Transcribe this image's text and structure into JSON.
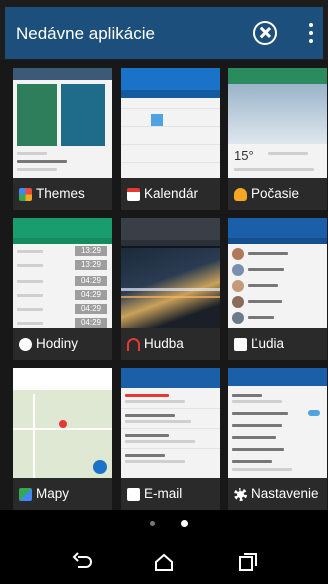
{
  "header": {
    "title": "Nedávne aplikácie",
    "clear_icon": "close-circle-icon",
    "menu_icon": "more-vert-icon"
  },
  "apps": [
    {
      "label": "Themes",
      "icon": "themes-icon",
      "color": "#e94b3c"
    },
    {
      "label": "Kalendár",
      "icon": "calendar-icon",
      "color": "#ffffff"
    },
    {
      "label": "Počasie",
      "icon": "weather-icon",
      "color": "#f5a623"
    },
    {
      "label": "Hodiny",
      "icon": "clock-icon",
      "color": "#ffffff"
    },
    {
      "label": "Hudba",
      "icon": "headphones-icon",
      "color": "#e53935"
    },
    {
      "label": "Ľudia",
      "icon": "contacts-icon",
      "color": "#ffffff"
    },
    {
      "label": "Mapy",
      "icon": "maps-icon",
      "color": "#34a853"
    },
    {
      "label": "E-mail",
      "icon": "mail-icon",
      "color": "#ffffff"
    },
    {
      "label": "Nastavenie",
      "icon": "gear-icon",
      "color": "#ffffff"
    }
  ],
  "weather": {
    "temp": "15°"
  },
  "clock_times": [
    "13:29",
    "13:29",
    "04:29",
    "04:29",
    "04:29",
    "04:29"
  ],
  "pager": {
    "pages": 2,
    "active": 2
  },
  "nav": {
    "back_icon": "back-icon",
    "home_icon": "home-icon",
    "recents_icon": "recents-icon"
  }
}
